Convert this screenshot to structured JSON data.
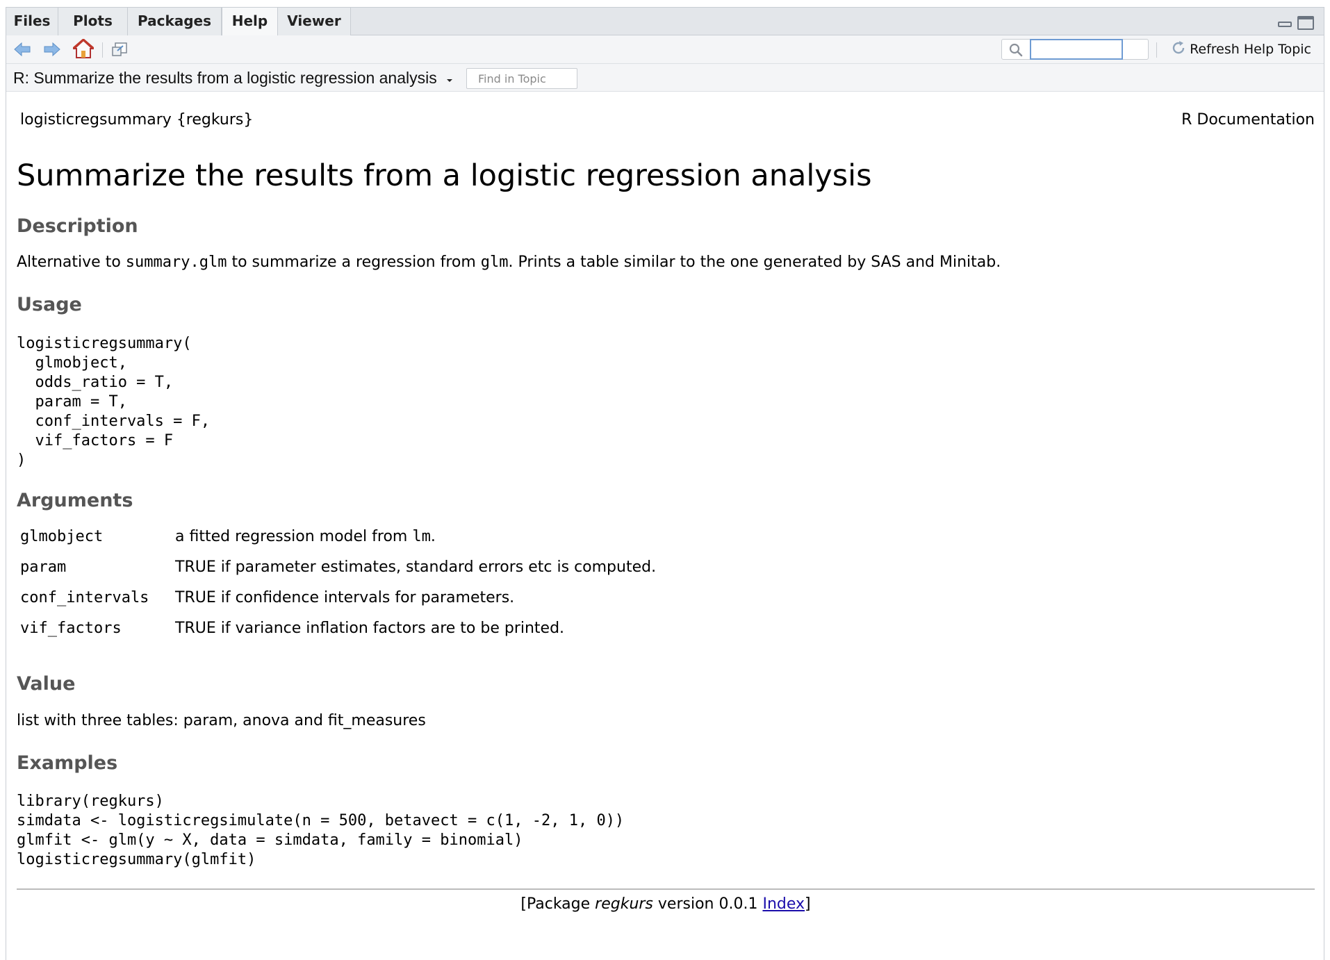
{
  "tabs": [
    {
      "label": "Files"
    },
    {
      "label": "Plots"
    },
    {
      "label": "Packages"
    },
    {
      "label": "Help"
    },
    {
      "label": "Viewer"
    }
  ],
  "toolbar": {
    "search_value": "",
    "refresh_label": "Refresh Help Topic"
  },
  "topic_bar": {
    "title": "R: Summarize the results from a logistic regression analysis",
    "find_placeholder": "Find in Topic"
  },
  "doc": {
    "name": "logisticregsummary {regkurs}",
    "source": "R Documentation",
    "title": "Summarize the results from a logistic regression analysis",
    "description_heading": "Description",
    "description": {
      "p1": "Alternative to ",
      "code1": "summary.glm",
      "p2": " to summarize a regression from ",
      "code2": "glm",
      "p3": ". Prints a table similar to the one generated by SAS and Minitab."
    },
    "usage_heading": "Usage",
    "usage_code": "logisticregsummary(\n  glmobject,\n  odds_ratio = T,\n  param = T,\n  conf_intervals = F,\n  vif_factors = F\n)",
    "arguments_heading": "Arguments",
    "arguments": [
      {
        "name": "glmobject",
        "desc_pre": "a fitted regression model from ",
        "desc_code": "lm",
        "desc_post": "."
      },
      {
        "name": "param",
        "desc_pre": "TRUE if parameter estimates, standard errors etc is computed.",
        "desc_code": "",
        "desc_post": ""
      },
      {
        "name": "conf_intervals",
        "desc_pre": "TRUE if confidence intervals for parameters.",
        "desc_code": "",
        "desc_post": ""
      },
      {
        "name": "vif_factors",
        "desc_pre": "TRUE if variance inflation factors are to be printed.",
        "desc_code": "",
        "desc_post": ""
      }
    ],
    "value_heading": "Value",
    "value_text": "list with three tables: param, anova and fit_measures",
    "examples_heading": "Examples",
    "examples_code": "library(regkurs)\nsimdata <- logisticregsimulate(n = 500, betavect = c(1, -2, 1, 0))\nglmfit <- glm(y ~ X, data = simdata, family = binomial)\nlogisticregsummary(glmfit)",
    "footer": {
      "pre": "[Package ",
      "pkg": "regkurs",
      "mid": " version 0.0.1 ",
      "link": "Index",
      "post": "]"
    }
  }
}
